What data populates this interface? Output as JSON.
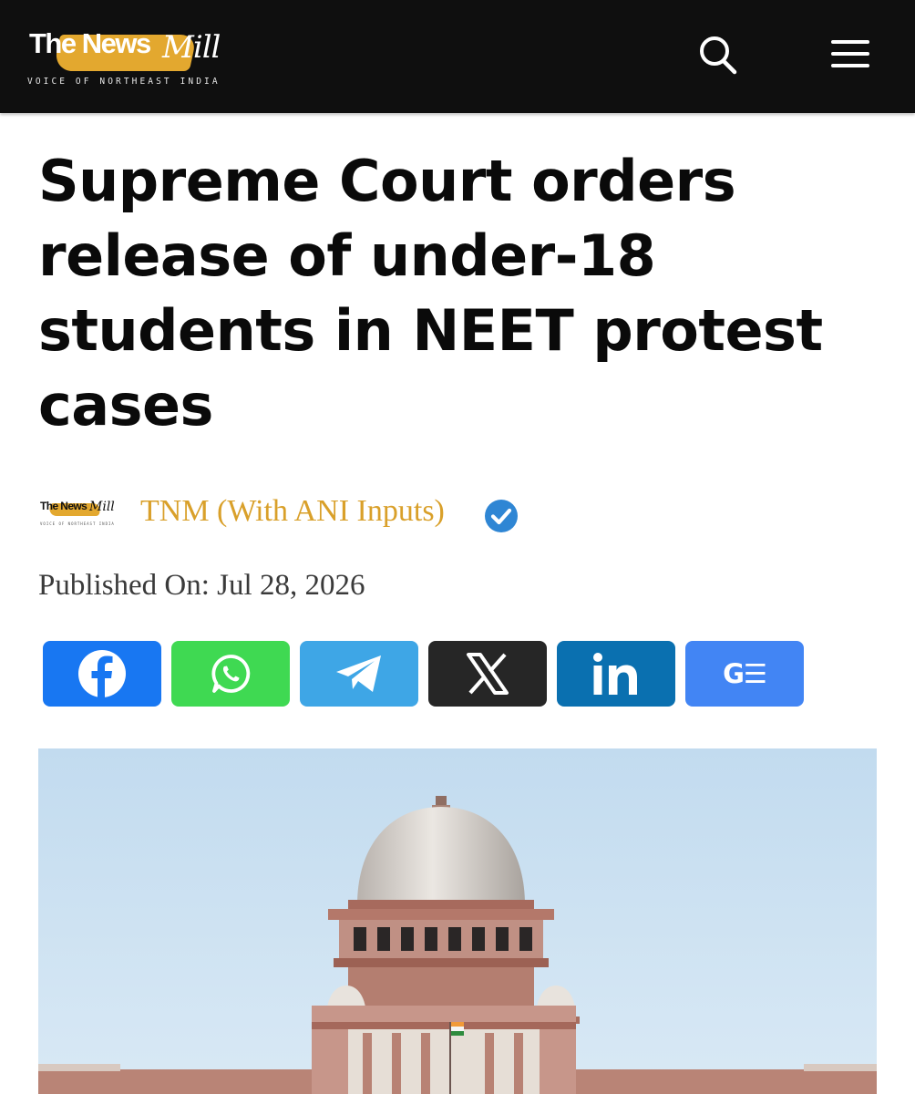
{
  "brand": {
    "name_part1": "The News",
    "name_part2": "Mill",
    "tagline": "VOICE OF NORTHEAST INDIA"
  },
  "header": {
    "icons": [
      "search-icon",
      "menu-icon"
    ]
  },
  "article": {
    "headline": "Supreme Court orders release of under-18 students in NEET protest cases",
    "author": "TNM (With ANI Inputs)",
    "published": "Published On: Jul 28, 2026"
  },
  "share": [
    {
      "network": "facebook",
      "icon": "facebook-icon",
      "color": "#1877f2"
    },
    {
      "network": "whatsapp",
      "icon": "whatsapp-icon",
      "color": "#3fd952"
    },
    {
      "network": "telegram",
      "icon": "telegram-icon",
      "color": "#3ea6e6"
    },
    {
      "network": "x",
      "icon": "x-icon",
      "color": "#262626"
    },
    {
      "network": "linkedin",
      "icon": "linkedin-icon",
      "color": "#0a70b0"
    },
    {
      "network": "google-news",
      "icon": "google-news-icon",
      "label": "G☰",
      "color": "#4285f4"
    }
  ],
  "colors": {
    "header_bg": "#0f0f0f",
    "brand_gold": "#e3a82f",
    "author_color": "#d9a02a",
    "verified_blue": "#2f86d4"
  }
}
